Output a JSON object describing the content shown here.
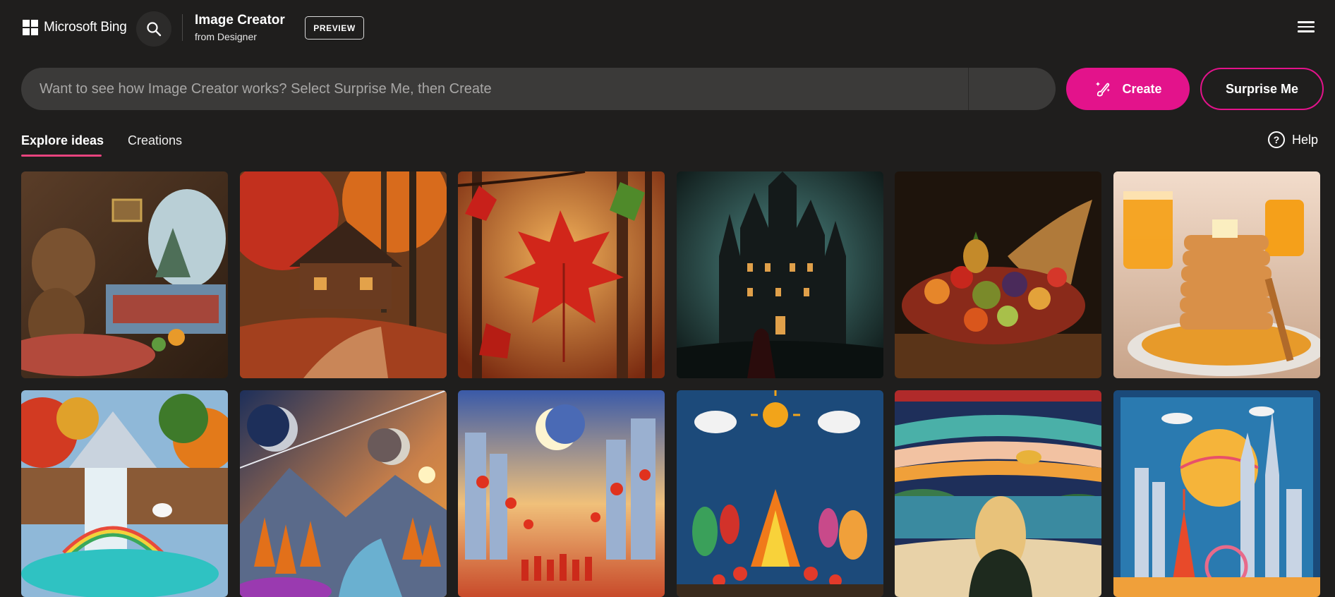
{
  "header": {
    "brand": "Microsoft Bing",
    "product_title": "Image Creator",
    "product_subtitle": "from Designer",
    "badge": "PREVIEW",
    "icons": {
      "search": "search-icon",
      "menu": "hamburger-menu-icon",
      "logo": "windows-logo-icon"
    }
  },
  "prompt": {
    "placeholder": "Want to see how Image Creator works? Select Surprise Me, then Create",
    "value": ""
  },
  "actions": {
    "create_label": "Create",
    "create_icon": "paintbrush-sparkle-icon",
    "surprise_label": "Surprise Me"
  },
  "tabs": [
    {
      "label": "Explore ideas",
      "active": true
    },
    {
      "label": "Creations",
      "active": false
    }
  ],
  "help": {
    "label": "Help",
    "icon": "question-circle-icon"
  },
  "colors": {
    "background": "#1f1e1d",
    "accent": "#e3138b",
    "prompt_bg": "#3b3a39",
    "tab_underline": "#e8437e"
  },
  "gallery": [
    {
      "name": "bears-in-cozy-cave"
    },
    {
      "name": "autumn-forest-cabin"
    },
    {
      "name": "red-maple-leaf"
    },
    {
      "name": "gothic-haunted-castle"
    },
    {
      "name": "harvest-cornucopia"
    },
    {
      "name": "pancake-stack-with-orange-juice"
    },
    {
      "name": "waterfall-rainbow-unicorn"
    },
    {
      "name": "planets-over-autumn-valley"
    },
    {
      "name": "moonlit-lantern-city-festival"
    },
    {
      "name": "felt-bonfire-celebration"
    },
    {
      "name": "felt-landscape-woman-and-bird"
    },
    {
      "name": "paper-craft-city-skyline"
    }
  ]
}
